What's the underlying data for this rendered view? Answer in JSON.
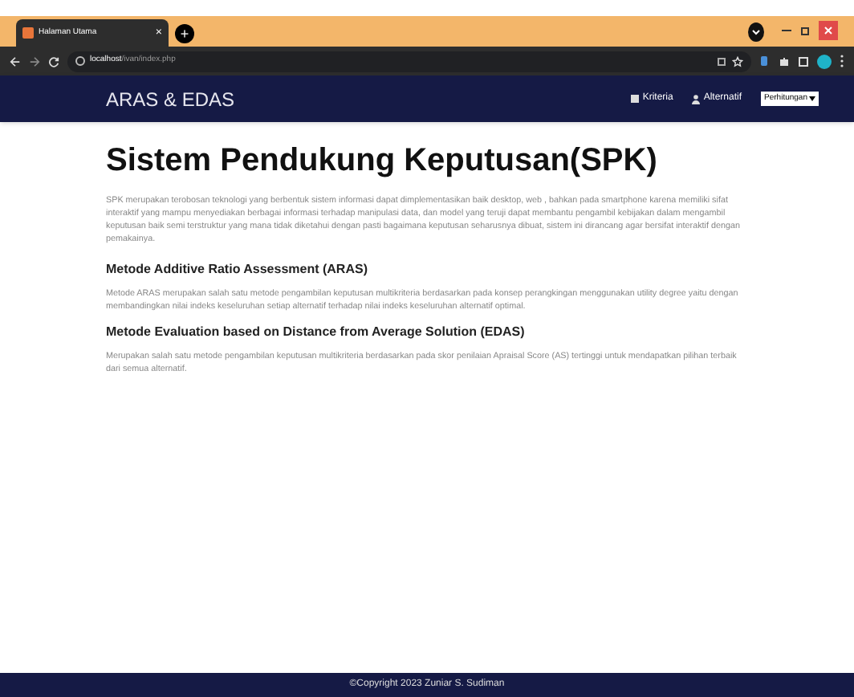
{
  "browser": {
    "tab_title": "Halaman Utama",
    "close": "×",
    "new_tab": "+",
    "url_host": "localhost",
    "url_path": "/ivan/index.php"
  },
  "navbar": {
    "brand": "ARAS & EDAS",
    "links": [
      "Kriteria",
      "Alternatif"
    ],
    "dropdown": "Perhitungan"
  },
  "title": "Sistem Pendukung Keputusan(SPK)",
  "intro": "SPK merupakan terobosan teknologi yang berbentuk sistem informasi dapat dimplementasikan baik desktop, web , bahkan pada smartphone karena memiliki sifat interaktif yang mampu menyediakan berbagai informasi terhadap manipulasi data, dan model yang teruji dapat membantu pengambil kebijakan dalam mengambil keputusan baik semi terstruktur yang mana tidak diketahui dengan pasti bagaimana keputusan seharusnya dibuat, sistem ini dirancang agar bersifat interaktif dengan pemakainya.",
  "sections": [
    {
      "heading": "Metode Additive Ratio Assessment (ARAS)",
      "text": "Metode ARAS merupakan salah satu metode pengambilan keputusan multikriteria berdasarkan pada konsep perangkingan menggunakan utility degree yaitu dengan membandingkan nilai indeks keseluruhan setiap alternatif terhadap nilai indeks keseluruhan alternatif optimal."
    },
    {
      "heading": "Metode Evaluation based on Distance from Average Solution (EDAS)",
      "text": "Merupakan salah satu metode pengambilan keputusan multikriteria berdasarkan pada skor penilaian Apraisal Score (AS) tertinggi untuk mendapatkan pilihan terbaik dari semua alternatif."
    }
  ],
  "footer": "©Copyright 2023 Zuniar S. Sudiman"
}
